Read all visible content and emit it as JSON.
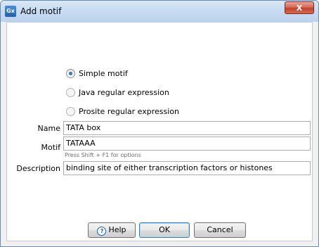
{
  "window": {
    "app_icon": "Gx",
    "title": "Add motif",
    "close_icon": "X"
  },
  "options": [
    {
      "label": "Simple motif",
      "checked": true
    },
    {
      "label": "Java regular expression",
      "checked": false
    },
    {
      "label": "Prosite regular expression",
      "checked": false
    }
  ],
  "fields": {
    "name_label": "Name",
    "name_value": "TATA box",
    "motif_label": "Motif",
    "motif_value": "TATAAA",
    "motif_hint": "Press Shift + F1 for options",
    "description_label": "Description",
    "description_value": "binding site of either transcription factors or histones"
  },
  "buttons": {
    "help_icon": "?",
    "help": "Help",
    "ok": "OK",
    "cancel": "Cancel"
  }
}
